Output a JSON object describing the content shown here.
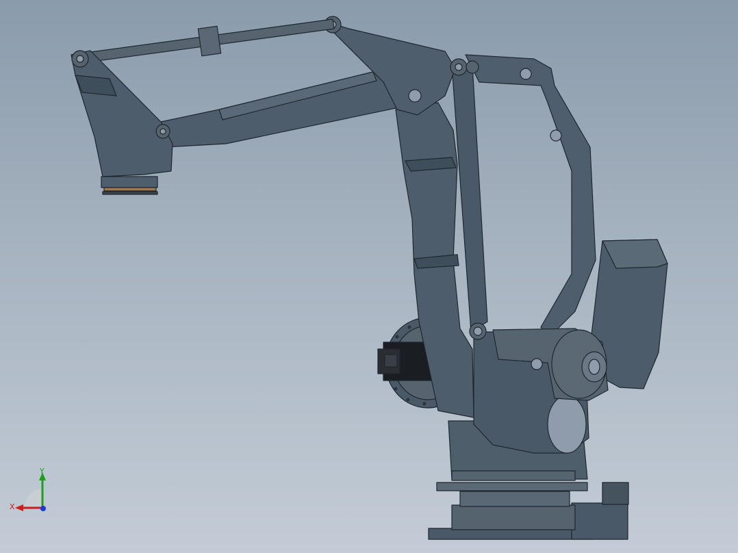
{
  "viewport": {
    "background_top": "#8a9bab",
    "background_bottom": "#c3ccd6"
  },
  "model": {
    "body_color": "#4d5d6b",
    "body_shade": "#3f4e5b",
    "edge_color": "#1e272f",
    "motor_color": "#1a1d21",
    "flange_accent": "#a0764f"
  },
  "triad": {
    "x_label": "X",
    "y_label": "Y",
    "x_color": "#d11a1a",
    "y_color": "#1ea01e",
    "z_color": "#1a3ad1"
  }
}
